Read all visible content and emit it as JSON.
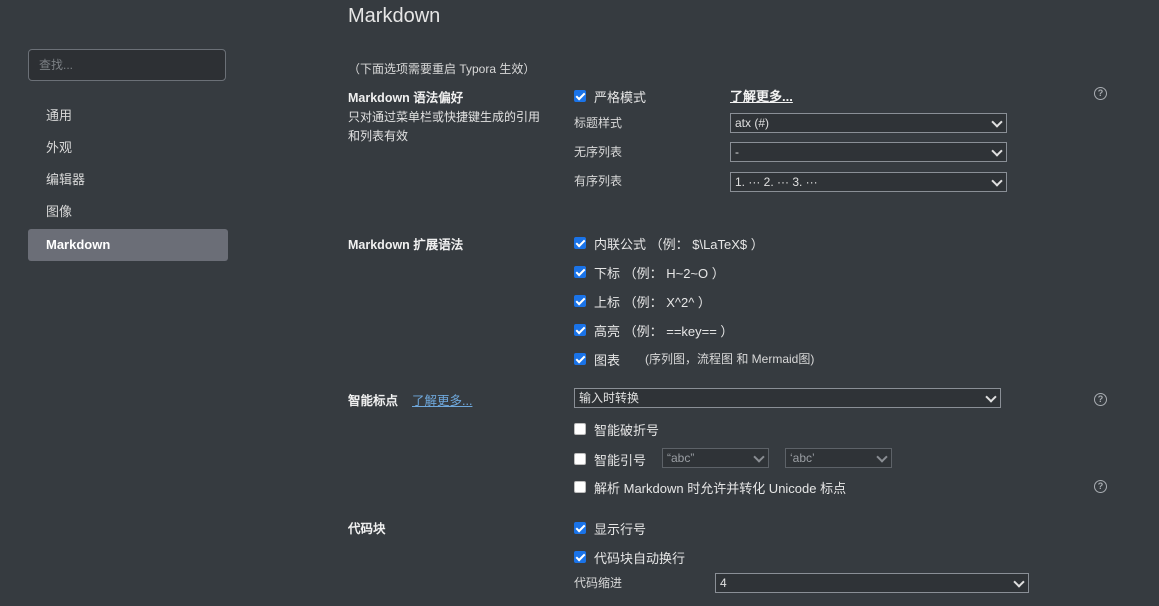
{
  "sidebar": {
    "search_placeholder": "查找...",
    "items": [
      {
        "label": "通用"
      },
      {
        "label": "外观"
      },
      {
        "label": "编辑器"
      },
      {
        "label": "图像"
      },
      {
        "label": "Markdown",
        "active": true
      }
    ]
  },
  "page": {
    "title": "Markdown",
    "restart_note": "（下面选项需要重启 Typora 生效）"
  },
  "syntax_pref": {
    "title": "Markdown 语法偏好",
    "desc_line1": "只对通过菜单栏或快捷键生成的引用",
    "desc_line2": "和列表有效",
    "strict_mode": {
      "label": "严格模式",
      "checked": true
    },
    "learn_more": "了解更多...",
    "heading_style": {
      "label": "标题样式",
      "value": "atx (#)"
    },
    "unordered_list": {
      "label": "无序列表",
      "value": "-"
    },
    "ordered_list": {
      "label": "有序列表",
      "value": "1. ··· 2. ··· 3. ···"
    }
  },
  "ext_syntax": {
    "title": "Markdown 扩展语法",
    "options": [
      {
        "label": "内联公式 （例： $\\LaTeX$ ）",
        "checked": true
      },
      {
        "label": "下标 （例： H~2~O ）",
        "checked": true
      },
      {
        "label": "上标 （例： X^2^ ）",
        "checked": true
      },
      {
        "label": "高亮 （例： ==key== ）",
        "checked": true
      },
      {
        "label": "图表",
        "note": "(序列图，流程图 和 Mermaid图)",
        "checked": true
      }
    ]
  },
  "smart_punct": {
    "title": "智能标点",
    "learn_more": "了解更多...",
    "mode": "输入时转换",
    "smart_dash": {
      "label": "智能破折号",
      "checked": false
    },
    "smart_quotes": {
      "label": "智能引号",
      "checked": false,
      "double_value": "“abc”",
      "single_value": "‘abc’"
    },
    "unicode_punct": {
      "label": "解析 Markdown 时允许并转化 Unicode 标点",
      "checked": false
    }
  },
  "code_block": {
    "title": "代码块",
    "line_numbers": {
      "label": "显示行号",
      "checked": true
    },
    "wrap": {
      "label": "代码块自动换行",
      "checked": true
    },
    "indent": {
      "label": "代码缩进",
      "value": "4"
    }
  },
  "icons": {
    "help": "?"
  },
  "colors": {
    "background": "#363b40",
    "checkbox": "#1a73e8",
    "link": "#6fa8dc",
    "active_nav": "#6b6e77"
  }
}
